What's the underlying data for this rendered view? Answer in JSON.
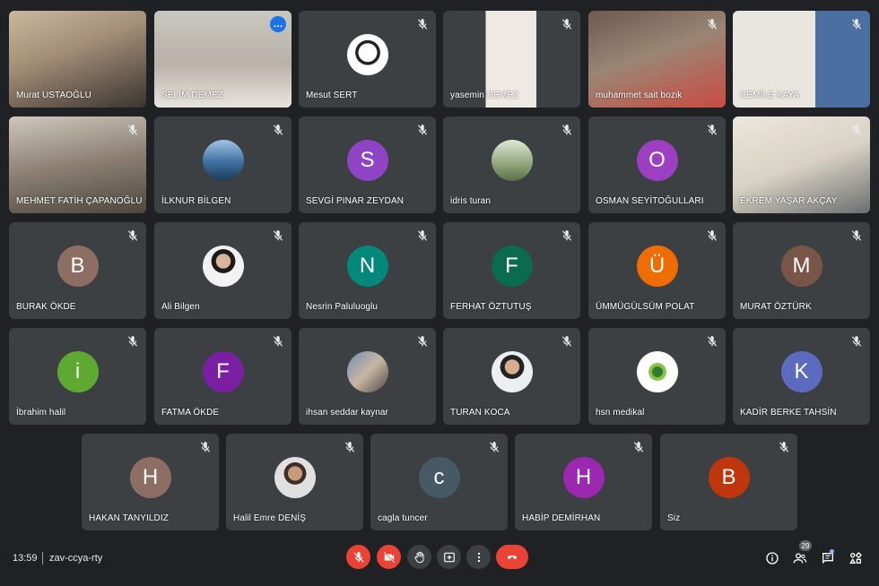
{
  "meeting": {
    "time": "13:59",
    "code": "zav-ccya-rty",
    "participant_count": "29"
  },
  "participants": [
    {
      "name": "Murat USTAOĞLU"
    },
    {
      "name": "SELİM DEMEZ"
    },
    {
      "name": "Mesut SERT"
    },
    {
      "name": "yasemin DEMEZ"
    },
    {
      "name": "muhammet sait bozik"
    },
    {
      "name": "CEMİLE KAYA"
    },
    {
      "name": "MEHMET FATİH ÇAPANOĞLU"
    },
    {
      "name": "İLKNUR BİLGEN"
    },
    {
      "name": "SEVGİ PINAR ZEYDAN",
      "initial": "S",
      "color": "#8e44c4"
    },
    {
      "name": "idris turan"
    },
    {
      "name": "OSMAN SEYİTOĞULLARI",
      "initial": "O",
      "color": "#9c3fc3"
    },
    {
      "name": "EKREM YAŞAR AKÇAY"
    },
    {
      "name": "BURAK ÖKDE",
      "initial": "B",
      "color": "#8d6e63"
    },
    {
      "name": "Ali Bilgen"
    },
    {
      "name": "Nesrin Paluluoglu",
      "initial": "N",
      "color": "#00897b"
    },
    {
      "name": "FERHAT ÖZTUTUŞ",
      "initial": "F",
      "color": "#0b6b4f"
    },
    {
      "name": "ÜMMÜGÜLSÜM POLAT",
      "initial": "Ü",
      "color": "#ef6c00"
    },
    {
      "name": "MURAT ÖZTÜRK",
      "initial": "M",
      "color": "#795548"
    },
    {
      "name": "İbrahim halil",
      "initial": "i",
      "color": "#5fa832"
    },
    {
      "name": "FATMA ÖKDE",
      "initial": "F",
      "color": "#7b1fa2"
    },
    {
      "name": "ihsan seddar kaynar"
    },
    {
      "name": "TURAN KOCA"
    },
    {
      "name": "hsn medikal"
    },
    {
      "name": "KADİR BERKE TAHSİN",
      "initial": "K",
      "color": "#5c6bc0"
    },
    {
      "name": "HAKAN TANYILDIZ",
      "initial": "H",
      "color": "#8d6e63"
    },
    {
      "name": "Halil Emre DENİŞ"
    },
    {
      "name": "cagla tuncer",
      "initial": "c",
      "color": "#455a64"
    },
    {
      "name": "HABİP DEMİRHAN",
      "initial": "H",
      "color": "#9c27b0"
    },
    {
      "name": "Siz",
      "initial": "B",
      "color": "#bf360c"
    }
  ],
  "colors": {
    "background": "#202124",
    "tile": "#3c4043",
    "accent": "#8ab4f8",
    "danger": "#ea4335"
  },
  "icons": {
    "mic_off": "mic-off-icon",
    "cam_off": "videocam-off-icon",
    "hand": "raise-hand-icon",
    "present": "present-screen-icon",
    "more": "more-options-icon",
    "hangup": "call-end-icon",
    "info": "info-icon",
    "people": "people-icon",
    "chat": "chat-icon",
    "activities": "activities-icon"
  }
}
